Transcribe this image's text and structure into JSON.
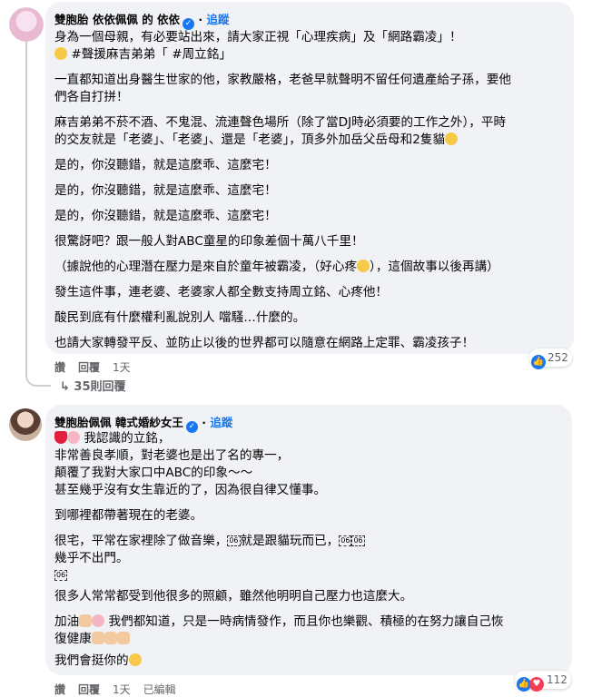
{
  "comments": [
    {
      "author": "雙胞胎 依依佩佩 的 依依",
      "follow": "追蹤",
      "lines": [
        "身為一個母親，有必要站出來，請大家正視「心理疾病」及「網路霸凌」！",
        "#聲援麻吉弟弟「 #周立銘」",
        "一直都知道出身醫生世家的他，家教嚴格，老爸早就聲明不留任何遺產給子孫，要他",
        "們各自打拼！",
        "麻吉弟弟不菸不酒、不鬼混、流連聲色場所（除了當DJ時必須要的工作之外），平時",
        "的交友就是「老婆」、「老婆」、還是「老婆」，頂多外加岳父岳母和2隻貓",
        "是的，你沒聽錯，就是這麼乖、這麼宅！",
        "是的，你沒聽錯，就是這麼乖、這麼宅！",
        "是的，你沒聽錯，就是這麼乖、這麼宅！",
        "很驚訝吧？跟一般人對ABC童星的印象差個十萬八千里！",
        "（據說他的心理潛在壓力是來自於童年被霸凌，（好心疼",
        "），這個故事以後再講）",
        "發生這件事，連老婆、老婆家人都全數支持周立銘、心疼他！",
        "酸民到底有什麼權利亂說別人 噹騷…什麼的。",
        "也請大家轉發平反、並防止以後的世界都可以隨意在網路上定罪、霸凌孩子！"
      ],
      "actions": {
        "like": "讚",
        "reply": "回覆",
        "time": "1天"
      },
      "reactions": "252",
      "replies_link": "35則回覆"
    },
    {
      "author": "雙胞胎佩佩 韓式婚紗女王",
      "follow": "追蹤",
      "lines": [
        "我認識的立銘，",
        "非常善良孝順，對老婆也是出了名的專一，",
        "顛覆了我對大家口中ABC的印象～～",
        "甚至幾乎沒有女生靠近的了，因為很自律又懂事。",
        "到哪裡都帶著現在的老婆。",
        "很宅，平常在家裡除了做音樂，",
        "就是跟貓玩而已，",
        "幾乎不出門。",
        "很多人常常都受到他很多的照顧，雖然他明明自己壓力也這麼大。",
        "加油",
        "我們都知道，只是一時病情發作，而且你也樂觀、積極的在努力讓自己恢",
        "復健康",
        "我們會挺你的"
      ],
      "box_label": "06",
      "actions": {
        "like": "讚",
        "reply": "回覆",
        "time": "1天",
        "edited": "已編輯"
      },
      "reactions": "112"
    }
  ]
}
